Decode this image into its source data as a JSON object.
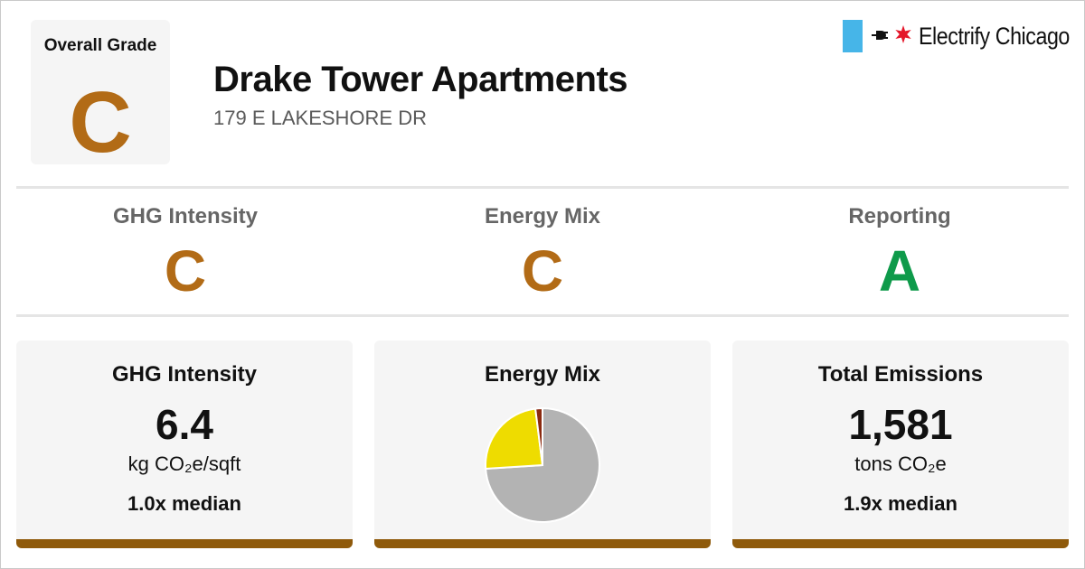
{
  "overall": {
    "label": "Overall Grade",
    "grade": "C",
    "grade_color": "#b26b16"
  },
  "building": {
    "name": "Drake Tower Apartments",
    "address": "179 E LAKESHORE DR"
  },
  "logo": {
    "flag_color": "#46b5e8",
    "plug_icon": "plug-icon",
    "plug_glyph": "⊣●",
    "star_glyph": "✶",
    "star_color": "#e4172a",
    "text": "Electrify Chicago"
  },
  "grades": [
    {
      "label": "GHG Intensity",
      "grade": "C",
      "color": "#b26b16"
    },
    {
      "label": "Energy Mix",
      "grade": "C",
      "color": "#b26b16"
    },
    {
      "label": "Reporting",
      "grade": "A",
      "color": "#0e9a4a"
    }
  ],
  "cards": {
    "ghg": {
      "title": "GHG Intensity",
      "value": "6.4",
      "unit": "kg CO₂e/sqft",
      "median": "1.0x median"
    },
    "energy_mix": {
      "title": "Energy Mix"
    },
    "emissions": {
      "title": "Total Emissions",
      "value": "1,581",
      "unit": "tons CO₂e",
      "median": "1.9x median"
    }
  },
  "accent_bar_color": "#8f5a0b",
  "chart_data": {
    "type": "pie",
    "title": "Energy Mix",
    "slices": [
      {
        "value": 74,
        "color": "#b3b3b3"
      },
      {
        "value": 24,
        "color": "#eedc00"
      },
      {
        "value": 2,
        "color": "#8b2a0f"
      }
    ],
    "start_angle_deg": 0,
    "direction": "clockwise"
  }
}
